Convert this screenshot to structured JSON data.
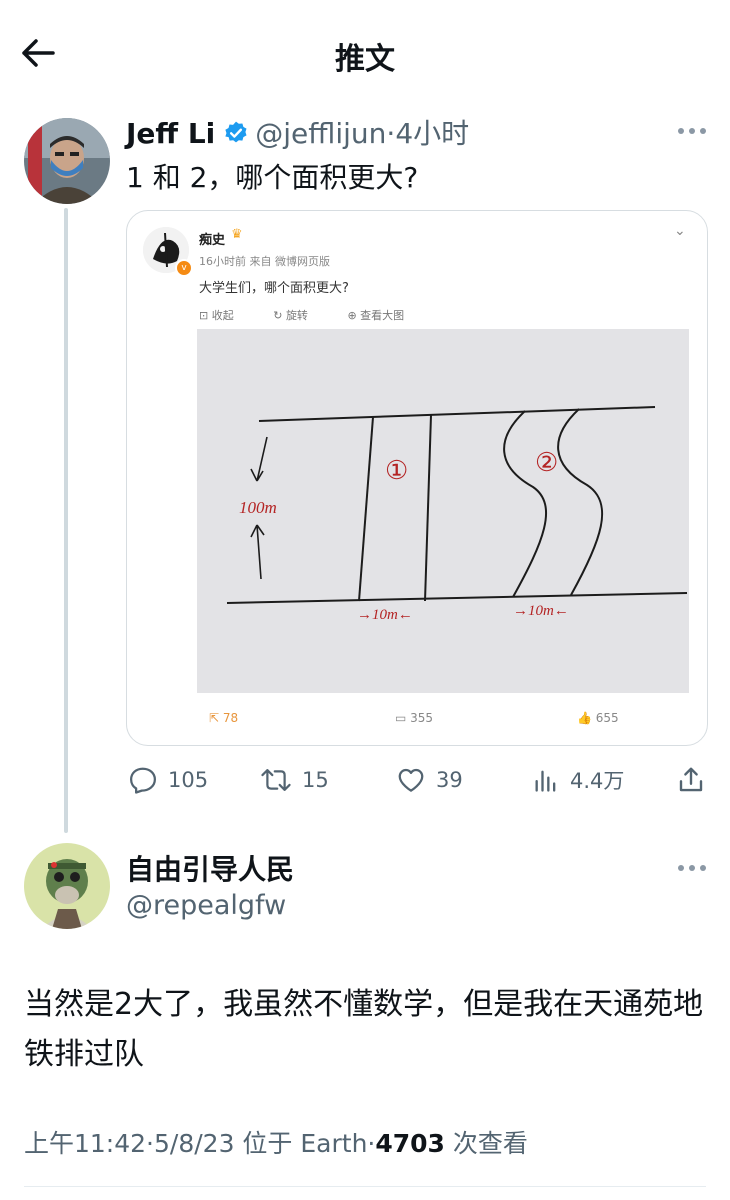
{
  "header": {
    "title": "推文"
  },
  "tweet": {
    "author_name": "Jeff Li",
    "handle": "@jefflijun",
    "dot": "·",
    "time": "4小时",
    "text": "1 和 2，哪个面积更大?",
    "embed": {
      "name": "痴史",
      "meta": "16小时前  来自 微博网页版",
      "text": "大学生们，哪个面积更大?",
      "actions": [
        "收起",
        "旋转",
        "查看大图"
      ],
      "photo_label_1": "①",
      "photo_label_2": "②",
      "photo_height": "100m",
      "photo_width_1": "→10m←",
      "photo_width_2": "→10m←",
      "forwards": "78",
      "comments": "355",
      "likes": "655"
    },
    "stats": {
      "replies": "105",
      "retweets": "15",
      "likes": "39",
      "views": "4.4万"
    }
  },
  "reply": {
    "author_name": "自由引导人民",
    "handle": "@repealgfw",
    "text": "当然是2大了，我虽然不懂数学，但是我在天通苑地铁排过队",
    "time": "上午11:42",
    "date": "5/8/23",
    "location": "位于 Earth",
    "views_count": "4703",
    "views_label": "次查看",
    "sep": "·"
  },
  "colors": {
    "text": "#0f1419",
    "secondary": "#536471",
    "verified": "#1d9bf0",
    "weibo_orange": "#f58b14"
  }
}
